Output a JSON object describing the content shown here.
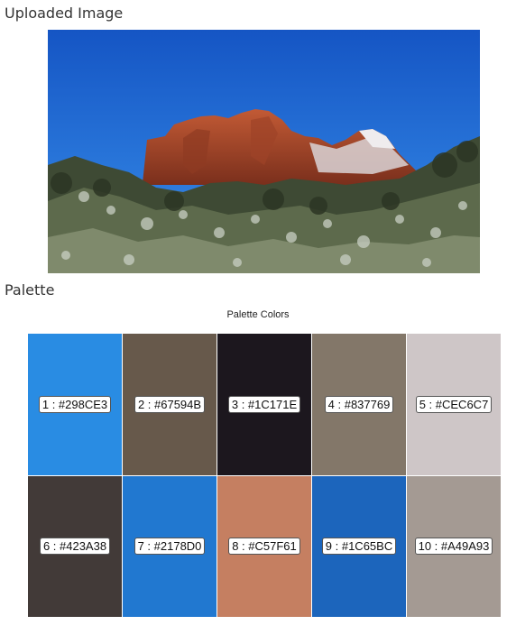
{
  "sections": {
    "uploaded_title": "Uploaded Image",
    "palette_title": "Palette"
  },
  "palette": {
    "caption": "Palette Colors",
    "swatches": [
      {
        "label": "1 : #298CE3",
        "color": "#298CE3"
      },
      {
        "label": "2 : #67594B",
        "color": "#67594B"
      },
      {
        "label": "3 : #1C171E",
        "color": "#1C171E"
      },
      {
        "label": "4 : #837769",
        "color": "#837769"
      },
      {
        "label": "5 : #CEC6C7",
        "color": "#CEC6C7"
      },
      {
        "label": "6 : #423A38",
        "color": "#423A38"
      },
      {
        "label": "7 : #2178D0",
        "color": "#2178D0"
      },
      {
        "label": "8 : #C57F61",
        "color": "#C57F61"
      },
      {
        "label": "9 : #1C65BC",
        "color": "#1C65BC"
      },
      {
        "label": "10 : #A49A93",
        "color": "#A49A93"
      }
    ]
  }
}
